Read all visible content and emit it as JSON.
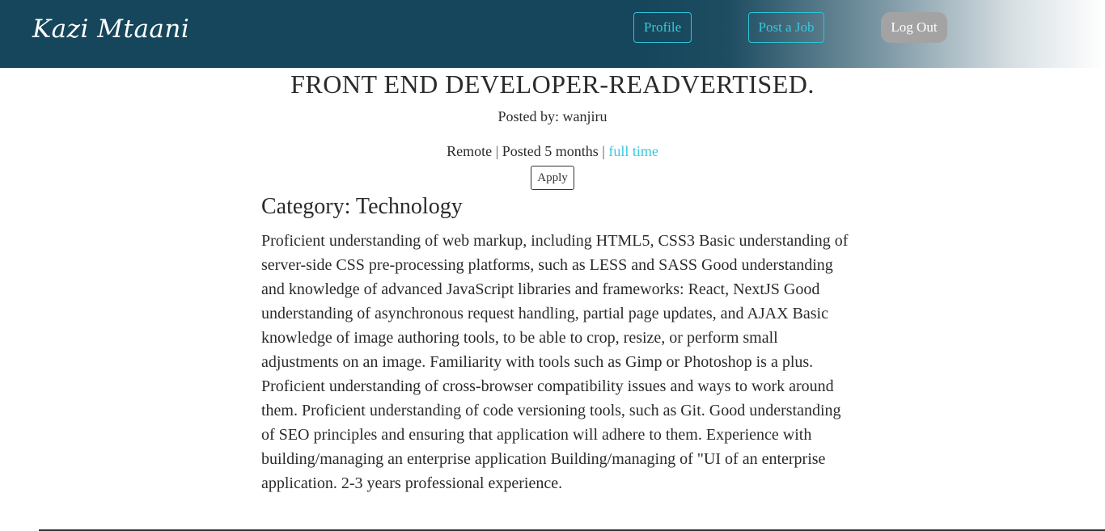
{
  "navbar": {
    "brand": "Kazi Mtaani",
    "profile_label": "Profile",
    "post_job_label": "Post a Job",
    "logout_label": "Log Out"
  },
  "job": {
    "title": "FRONT END DEVELOPER-READVERTISED.",
    "posted_by_label": "Posted by: ",
    "posted_by": "wanjiru",
    "location": "Remote",
    "separator": " | ",
    "posted_ago": "Posted 5 months",
    "job_type": "full time",
    "apply_label": "Apply",
    "category_label": "Category: ",
    "category": "Technology",
    "description": "Proficient understanding of web markup, including HTML5, CSS3 Basic understanding of server-side CSS pre-processing platforms, such as LESS and SASS Good understanding and knowledge of advanced JavaScript libraries and frameworks: React, NextJS Good understanding of asynchronous request handling, partial page updates, and AJAX Basic knowledge of image authoring tools, to be able to crop, resize, or perform small adjustments on an image. Familiarity with tools such as Gimp or Photoshop is a plus. Proficient understanding of cross-browser compatibility issues and ways to work around them. Proficient understanding of code versioning tools, such as Git. Good understanding of SEO principles and ensuring that application will adhere to them. Experience with building/managing an enterprise application Building/managing of \"UI of an enterprise application. 2-3 years professional experience."
  },
  "colors": {
    "navbar": "#15465b",
    "accent": "#35c9de",
    "logout_button": "#a3a3a3"
  }
}
